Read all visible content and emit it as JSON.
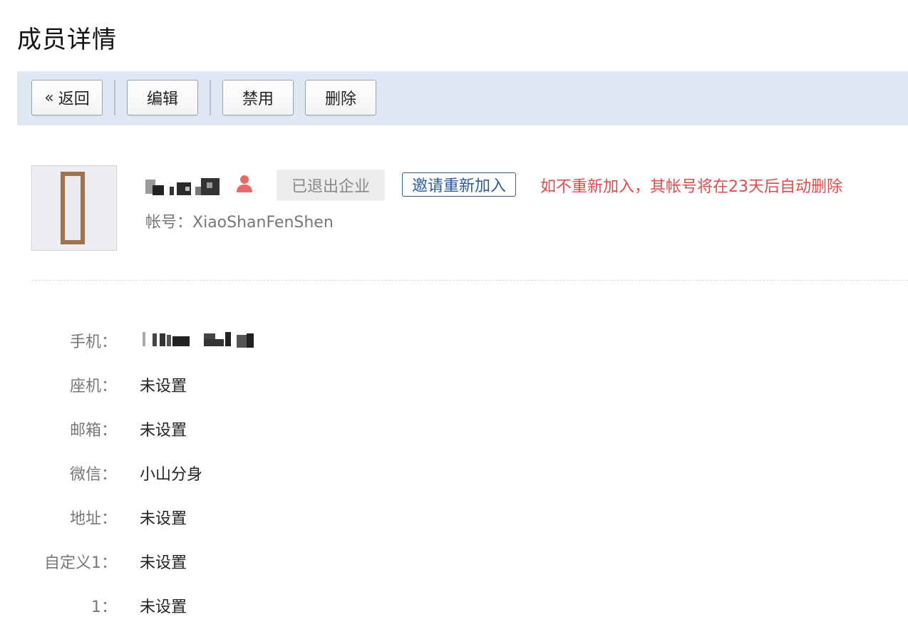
{
  "page": {
    "title": "成员详情"
  },
  "toolbar": {
    "back_label": "返回",
    "edit_label": "编辑",
    "disable_label": "禁用",
    "delete_label": "删除"
  },
  "profile": {
    "status_badge": "已退出企业",
    "invite_label": "邀请重新加入",
    "warning": "如不重新加入，其帐号将在23天后自动删除",
    "account_label": "帐号：",
    "account_value": "XiaoShanFenShen",
    "accent_color": "#e04b4b",
    "link_color": "#2e5d96"
  },
  "fields": [
    {
      "label": "手机：",
      "value": ""
    },
    {
      "label": "座机：",
      "value": "未设置"
    },
    {
      "label": "邮箱：",
      "value": "未设置"
    },
    {
      "label": "微信：",
      "value": "小山分身"
    },
    {
      "label": "地址：",
      "value": "未设置"
    },
    {
      "label": "自定义1：",
      "value": "未设置"
    },
    {
      "label": "1：",
      "value": "未设置"
    }
  ]
}
